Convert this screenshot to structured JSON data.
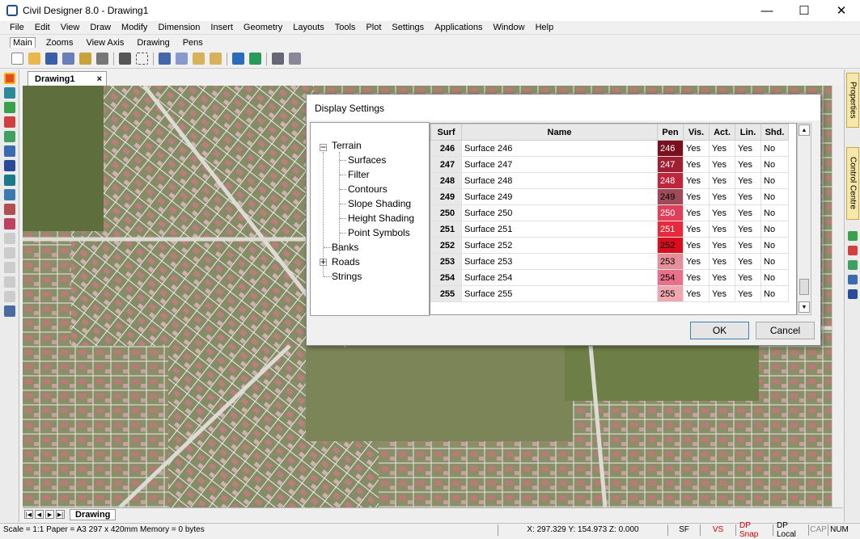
{
  "window": {
    "title": "Civil Designer 8.0 - Drawing1",
    "minimize": "—",
    "maximize": "☐",
    "close": "✕"
  },
  "menu": [
    "File",
    "Edit",
    "View",
    "Draw",
    "Modify",
    "Dimension",
    "Insert",
    "Geometry",
    "Layouts",
    "Tools",
    "Plot",
    "Settings",
    "Applications",
    "Window",
    "Help"
  ],
  "toolbar_tabs": [
    "Main",
    "Zooms",
    "View Axis",
    "Drawing",
    "Pens"
  ],
  "doc_tab": {
    "label": "Drawing1",
    "close": "×"
  },
  "side_tabs": {
    "properties": "Properties",
    "control_centre": "Control Centre"
  },
  "sheet_tab": "Drawing",
  "dialog": {
    "title": "Display Settings",
    "tree": {
      "terrain": "Terrain",
      "surfaces": "Surfaces",
      "filter": "Filter",
      "contours": "Contours",
      "slope_shading": "Slope Shading",
      "height_shading": "Height Shading",
      "point_symbols": "Point Symbols",
      "banks": "Banks",
      "roads": "Roads",
      "strings": "Strings"
    },
    "columns": [
      "Surf",
      "Name",
      "Pen",
      "Vis.",
      "Act.",
      "Lin.",
      "Shd."
    ],
    "rows": [
      {
        "surf": "246",
        "name": "Surface 246",
        "pen": "246",
        "vis": "Yes",
        "act": "Yes",
        "lin": "Yes",
        "shd": "No",
        "color": "#7a0f1e",
        "text": "#ffffff"
      },
      {
        "surf": "247",
        "name": "Surface 247",
        "pen": "247",
        "vis": "Yes",
        "act": "Yes",
        "lin": "Yes",
        "shd": "No",
        "color": "#a21f33",
        "text": "#ffffff"
      },
      {
        "surf": "248",
        "name": "Surface 248",
        "pen": "248",
        "vis": "Yes",
        "act": "Yes",
        "lin": "Yes",
        "shd": "No",
        "color": "#c0263b",
        "text": "#ffffff"
      },
      {
        "surf": "249",
        "name": "Surface 249",
        "pen": "249",
        "vis": "Yes",
        "act": "Yes",
        "lin": "Yes",
        "shd": "No",
        "color": "#9e4a58",
        "text": "#000000"
      },
      {
        "surf": "250",
        "name": "Surface 250",
        "pen": "250",
        "vis": "Yes",
        "act": "Yes",
        "lin": "Yes",
        "shd": "No",
        "color": "#e0405a",
        "text": "#ffffff"
      },
      {
        "surf": "251",
        "name": "Surface 251",
        "pen": "251",
        "vis": "Yes",
        "act": "Yes",
        "lin": "Yes",
        "shd": "No",
        "color": "#e8283c",
        "text": "#ffffff"
      },
      {
        "surf": "252",
        "name": "Surface 252",
        "pen": "252",
        "vis": "Yes",
        "act": "Yes",
        "lin": "Yes",
        "shd": "No",
        "color": "#d80e1e",
        "text": "#000000"
      },
      {
        "surf": "253",
        "name": "Surface 253",
        "pen": "253",
        "vis": "Yes",
        "act": "Yes",
        "lin": "Yes",
        "shd": "No",
        "color": "#e68f9b",
        "text": "#000000"
      },
      {
        "surf": "254",
        "name": "Surface 254",
        "pen": "254",
        "vis": "Yes",
        "act": "Yes",
        "lin": "Yes",
        "shd": "No",
        "color": "#e8708a",
        "text": "#000000"
      },
      {
        "surf": "255",
        "name": "Surface 255",
        "pen": "255",
        "vis": "Yes",
        "act": "Yes",
        "lin": "Yes",
        "shd": "No",
        "color": "#f0a8b0",
        "text": "#000000"
      }
    ],
    "ok": "OK",
    "cancel": "Cancel"
  },
  "status": {
    "left": "Scale = 1:1   Paper = A3 297 x 420mm   Memory = 0 bytes",
    "coords": "X: 297.329 Y: 154.973 Z: 0.000",
    "sf": "SF",
    "vs": "VS",
    "dpsnap": "DP Snap",
    "dplocal": "DP Local",
    "cap": "CAP",
    "num": "NUM"
  },
  "colors": {
    "status_red": "#cc0000",
    "ok_border": "#3c7fb1"
  }
}
